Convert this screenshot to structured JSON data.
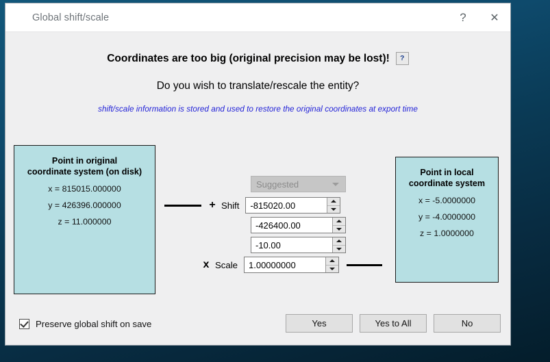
{
  "window": {
    "title": "Global shift/scale",
    "icon": "cloudcompare-logo-icon",
    "help_button": "?",
    "close_button": "✕"
  },
  "content": {
    "headline": "Coordinates are too big (original precision may be lost)!",
    "headline_help_badge": "?",
    "question": "Do you wish to translate/rescale the entity?",
    "note": "shift/scale information is stored and used to restore the original coordinates at export time"
  },
  "original_panel": {
    "title_line1": "Point in original",
    "title_line2": "coordinate system (on disk)",
    "x": "x = 815015.000000",
    "y": "y = 426396.000000",
    "z": "z = 11.000000"
  },
  "local_panel": {
    "title_line1": "Point in local",
    "title_line2": "coordinate system",
    "x": "x = -5.0000000",
    "y": "y = -4.0000000",
    "z": "z = 1.0000000"
  },
  "controls": {
    "preset_combo": {
      "value": "Suggested",
      "enabled": false
    },
    "shift_label": "Shift",
    "shift_sign": "+",
    "shift_x": "-815020.00",
    "shift_y": "-426400.00",
    "shift_z": "-10.00",
    "scale_label": "Scale",
    "scale_sign": "x",
    "scale_value": "1.00000000"
  },
  "footer": {
    "preserve_checkbox_label": "Preserve global shift on save",
    "preserve_checked": true,
    "buttons": {
      "yes": "Yes",
      "yes_to_all": "Yes to All",
      "no": "No"
    }
  },
  "colors": {
    "panel_background": "#b6dfe3",
    "note_text": "#2424d8",
    "dialog_background": "#efeff0",
    "viewport_background": "#0b3b57"
  }
}
